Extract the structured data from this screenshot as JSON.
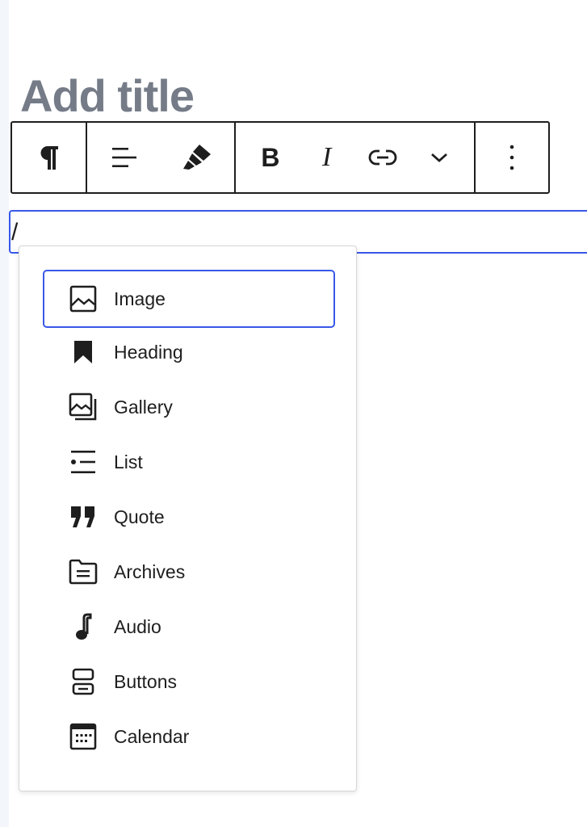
{
  "editor": {
    "title_placeholder": "Add title",
    "paragraph_text": "/"
  },
  "toolbar": {
    "groups": [
      {
        "buttons": [
          {
            "icon": "paragraph-icon"
          }
        ]
      },
      {
        "buttons": [
          {
            "icon": "align-left-icon"
          },
          {
            "icon": "highlighter-icon"
          }
        ]
      },
      {
        "buttons": [
          {
            "icon": "bold-icon",
            "glyph": "B"
          },
          {
            "icon": "italic-icon",
            "glyph": "I"
          },
          {
            "icon": "link-icon"
          },
          {
            "icon": "chevron-down-icon"
          }
        ]
      },
      {
        "buttons": [
          {
            "icon": "more-vertical-icon"
          }
        ]
      }
    ]
  },
  "inserter": {
    "items": [
      {
        "label": "Image",
        "icon": "image-icon",
        "selected": true
      },
      {
        "label": "Heading",
        "icon": "bookmark-heading-icon"
      },
      {
        "label": "Gallery",
        "icon": "gallery-icon"
      },
      {
        "label": "List",
        "icon": "list-icon"
      },
      {
        "label": "Quote",
        "icon": "quote-icon"
      },
      {
        "label": "Archives",
        "icon": "archive-folder-icon"
      },
      {
        "label": "Audio",
        "icon": "music-note-icon"
      },
      {
        "label": "Buttons",
        "icon": "buttons-icon"
      },
      {
        "label": "Calendar",
        "icon": "calendar-icon"
      }
    ]
  },
  "colors": {
    "accent": "#3858e9",
    "title_placeholder": "#757c88",
    "text": "#1e1e1e",
    "canvas_strip": "#f3f6fa"
  }
}
